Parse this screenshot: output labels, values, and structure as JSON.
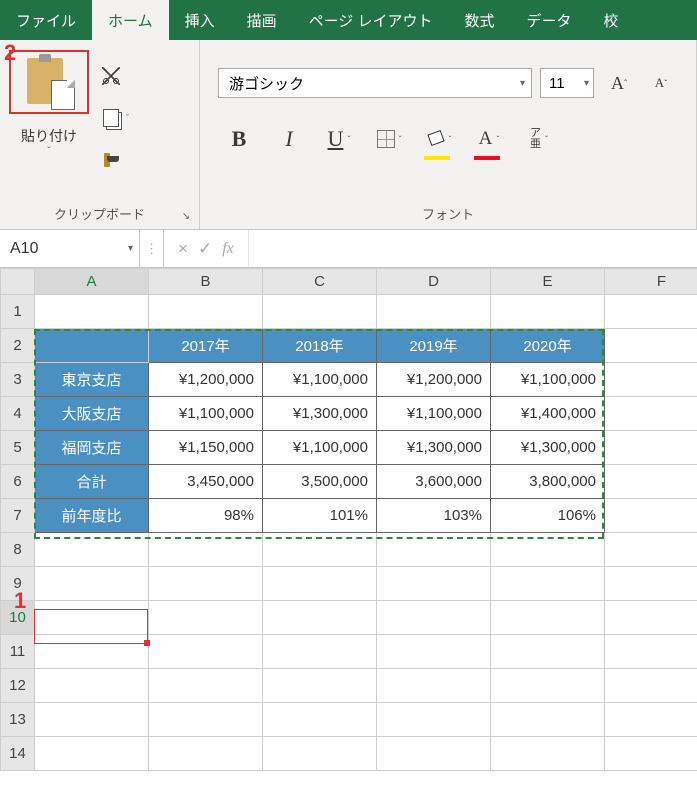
{
  "tabs": {
    "file": "ファイル",
    "home": "ホーム",
    "insert": "挿入",
    "draw": "描画",
    "pagelayout": "ページ レイアウト",
    "formulas": "数式",
    "data": "データ",
    "review_partial": "校"
  },
  "ribbon": {
    "clipboard": {
      "paste_label": "貼り付け",
      "group_label": "クリップボード"
    },
    "font": {
      "font_name": "游ゴシック",
      "font_size": "11",
      "increase_font": "A",
      "decrease_font": "A",
      "bold": "B",
      "italic": "I",
      "underline": "U",
      "fontcolor_letter": "A",
      "ruby_top": "ア",
      "ruby_bottom": "亜",
      "group_label": "フォント",
      "fill_swatch": "#ffe600",
      "font_swatch": "#e81123"
    }
  },
  "namebox": "A10",
  "fx": {
    "x": "×",
    "check": "✓",
    "label": "fx"
  },
  "columns": [
    "A",
    "B",
    "C",
    "D",
    "E",
    "F"
  ],
  "rows": [
    "1",
    "2",
    "3",
    "4",
    "5",
    "6",
    "7",
    "8",
    "9",
    "10",
    "11",
    "12",
    "13",
    "14"
  ],
  "table": {
    "col_headers": [
      "2017年",
      "2018年",
      "2019年",
      "2020年"
    ],
    "row_headers": [
      "東京支店",
      "大阪支店",
      "福岡支店",
      "合計",
      "前年度比"
    ],
    "cells": [
      [
        "¥1,200,000",
        "¥1,100,000",
        "¥1,200,000",
        "¥1,100,000"
      ],
      [
        "¥1,100,000",
        "¥1,300,000",
        "¥1,100,000",
        "¥1,400,000"
      ],
      [
        "¥1,150,000",
        "¥1,100,000",
        "¥1,300,000",
        "¥1,300,000"
      ],
      [
        "3,450,000",
        "3,500,000",
        "3,600,000",
        "3,800,000"
      ],
      [
        "98%",
        "101%",
        "103%",
        "106%"
      ]
    ]
  },
  "callouts": {
    "c1": "1",
    "c2": "2"
  },
  "glyphs": {
    "down_triangle": "▾",
    "up_caret": "ˆ",
    "down_caret": "ˇ",
    "box_arrow": "↘"
  }
}
